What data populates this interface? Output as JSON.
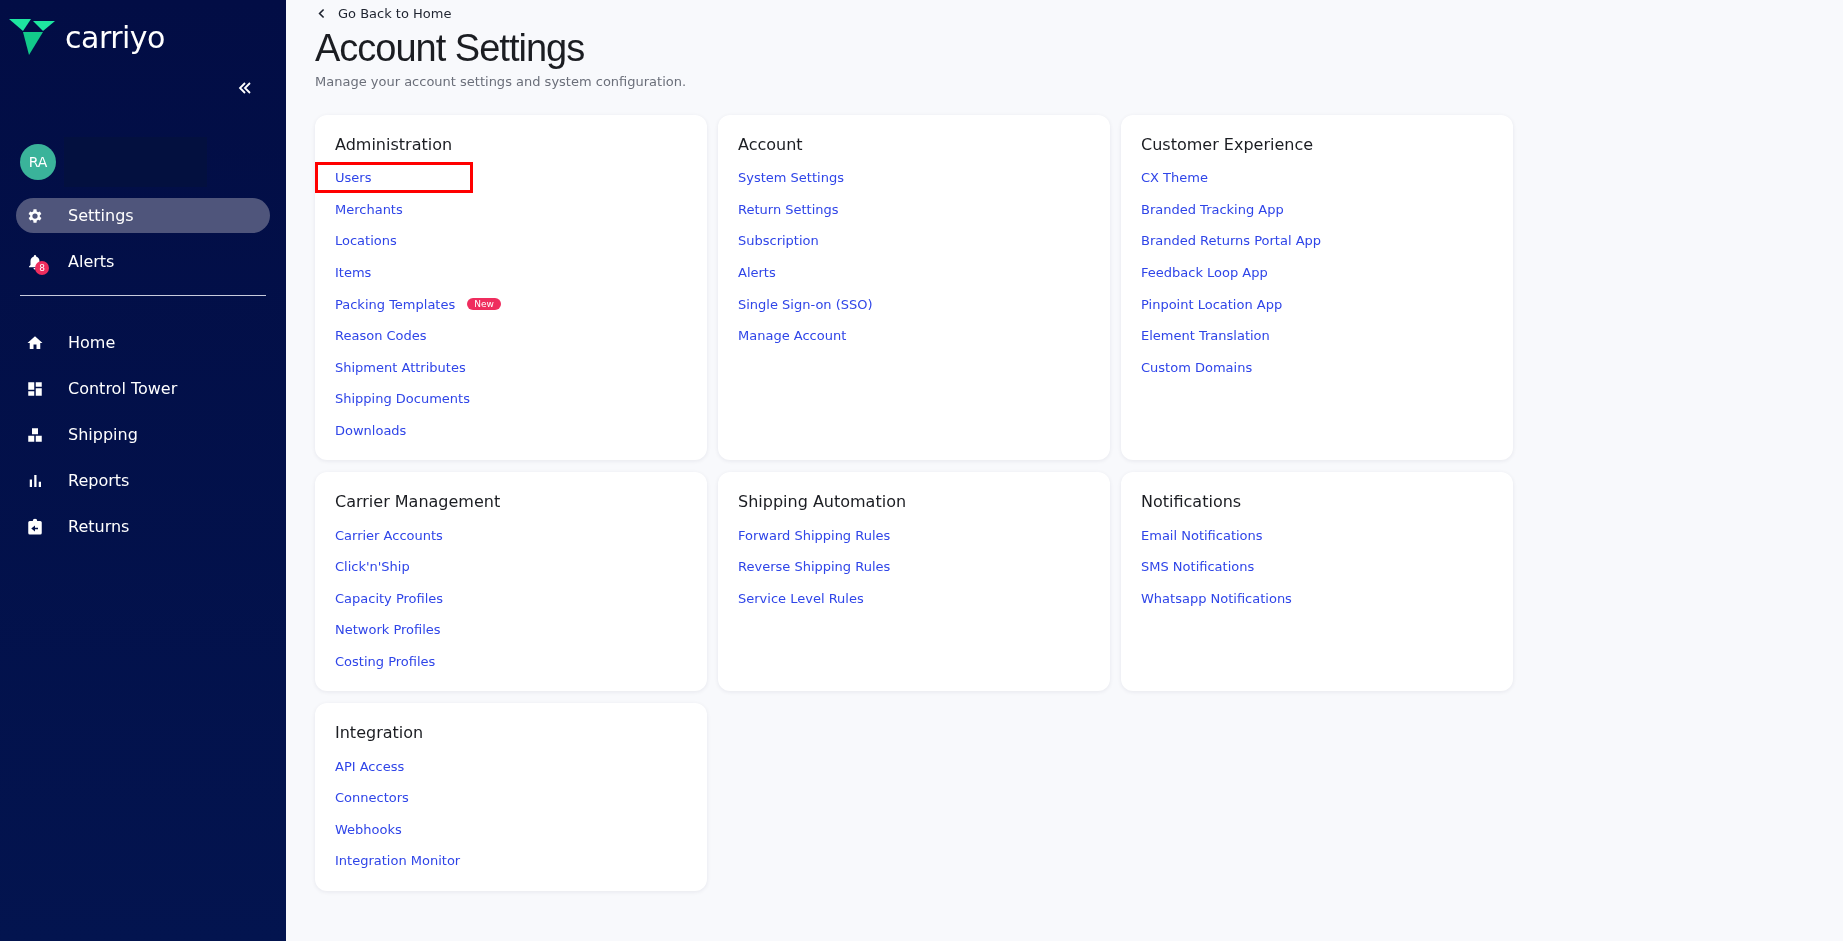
{
  "sidebar": {
    "logo": "carriyo",
    "avatar": "RA",
    "top_items": [
      {
        "label": "Settings",
        "selected": true
      },
      {
        "label": "Alerts",
        "selected": false,
        "badge": "8"
      }
    ],
    "items": [
      {
        "label": "Home",
        "selected": false
      },
      {
        "label": "Control Tower",
        "selected": false
      },
      {
        "label": "Shipping",
        "selected": false
      },
      {
        "label": "Reports",
        "selected": false
      },
      {
        "label": "Returns",
        "selected": false
      }
    ]
  },
  "back_link": "Go Back to Home",
  "title": "Account Settings",
  "subtitle": "Manage your account settings and system configuration.",
  "cards": [
    {
      "title": "Administration",
      "links": [
        {
          "label": "Users",
          "highlighted": true
        },
        {
          "label": "Merchants",
          "highlighted": false
        },
        {
          "label": "Locations",
          "highlighted": false
        },
        {
          "label": "Items",
          "highlighted": false
        },
        {
          "label": "Packing Templates",
          "highlighted": false,
          "badge": "New"
        },
        {
          "label": "Reason Codes",
          "highlighted": false
        },
        {
          "label": "Shipment Attributes",
          "highlighted": false
        },
        {
          "label": "Shipping Documents",
          "highlighted": false
        },
        {
          "label": "Downloads",
          "highlighted": false
        }
      ]
    },
    {
      "title": "Account",
      "links": [
        {
          "label": "System Settings",
          "highlighted": false
        },
        {
          "label": "Return Settings",
          "highlighted": false
        },
        {
          "label": "Subscription",
          "highlighted": false
        },
        {
          "label": "Alerts",
          "highlighted": false
        },
        {
          "label": "Single Sign-on (SSO)",
          "highlighted": false
        },
        {
          "label": "Manage Account",
          "highlighted": false
        }
      ]
    },
    {
      "title": "Customer Experience",
      "links": [
        {
          "label": "CX Theme",
          "highlighted": false
        },
        {
          "label": "Branded Tracking App",
          "highlighted": false
        },
        {
          "label": "Branded Returns Portal App",
          "highlighted": false
        },
        {
          "label": "Feedback Loop App",
          "highlighted": false
        },
        {
          "label": "Pinpoint Location App",
          "highlighted": false
        },
        {
          "label": "Element Translation",
          "highlighted": false
        },
        {
          "label": "Custom Domains",
          "highlighted": false
        }
      ]
    },
    {
      "title": "Carrier Management",
      "links": [
        {
          "label": "Carrier Accounts",
          "highlighted": false
        },
        {
          "label": "Click'n'Ship",
          "highlighted": false
        },
        {
          "label": "Capacity Profiles",
          "highlighted": false
        },
        {
          "label": "Network Profiles",
          "highlighted": false
        },
        {
          "label": "Costing Profiles",
          "highlighted": false
        }
      ]
    },
    {
      "title": "Shipping Automation",
      "links": [
        {
          "label": "Forward Shipping Rules",
          "highlighted": false
        },
        {
          "label": "Reverse Shipping Rules",
          "highlighted": false
        },
        {
          "label": "Service Level Rules",
          "highlighted": false
        }
      ]
    },
    {
      "title": "Notifications",
      "links": [
        {
          "label": "Email Notifications",
          "highlighted": false
        },
        {
          "label": "SMS Notifications",
          "highlighted": false
        },
        {
          "label": "Whatsapp Notifications",
          "highlighted": false
        }
      ]
    },
    {
      "title": "Integration",
      "links": [
        {
          "label": "API Access",
          "highlighted": false
        },
        {
          "label": "Connectors",
          "highlighted": false
        },
        {
          "label": "Webhooks",
          "highlighted": false
        },
        {
          "label": "Integration Monitor",
          "highlighted": false
        }
      ]
    }
  ]
}
